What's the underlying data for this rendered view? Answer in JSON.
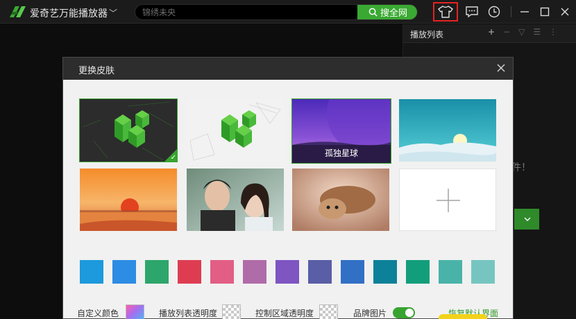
{
  "app": {
    "title": "爱奇艺万能播放器",
    "title_caret": "﹀",
    "brand_color": "#3aa933"
  },
  "search": {
    "placeholder": "锦绣未央",
    "clear": "✕",
    "button_label": "搜全网"
  },
  "toolbar": {
    "icons": [
      "skin-icon",
      "message-icon",
      "history-icon",
      "minimize-icon",
      "maximize-icon",
      "close-icon"
    ]
  },
  "playlist": {
    "title": "播放列表",
    "tools": [
      "+",
      "−",
      "▽",
      "☰",
      "⋮"
    ],
    "empty_fragment": "件！"
  },
  "dialog": {
    "title": "更换皮肤",
    "skins": [
      {
        "name": "dark-logo",
        "caption": "",
        "selected": true
      },
      {
        "name": "light-logo",
        "caption": "",
        "selected": false
      },
      {
        "name": "lonely-planet",
        "caption": "孤独星球",
        "selected": false
      },
      {
        "name": "snow-sunrise",
        "caption": "",
        "selected": false
      },
      {
        "name": "sunset-desert",
        "caption": "",
        "selected": false
      },
      {
        "name": "couple-photo",
        "caption": "",
        "selected": false
      },
      {
        "name": "cat-photo",
        "caption": "",
        "selected": false
      },
      {
        "name": "add-custom",
        "caption": "",
        "selected": false
      }
    ],
    "swatches": [
      "#1d99dd",
      "#2d8ce3",
      "#2da66b",
      "#de3d51",
      "#e25e85",
      "#b06ba9",
      "#7e55c1",
      "#5a5ea6",
      "#3270c6",
      "#0c8199",
      "#139e7b",
      "#49b3a9",
      "#76c5c1"
    ],
    "custom_color_label": "自定义颜色",
    "playlist_opacity_label": "播放列表透明度",
    "control_opacity_label": "控制区域透明度",
    "brand_image_label": "品牌图片",
    "brand_image_on": true,
    "restore_label": "恢复默认界面"
  }
}
